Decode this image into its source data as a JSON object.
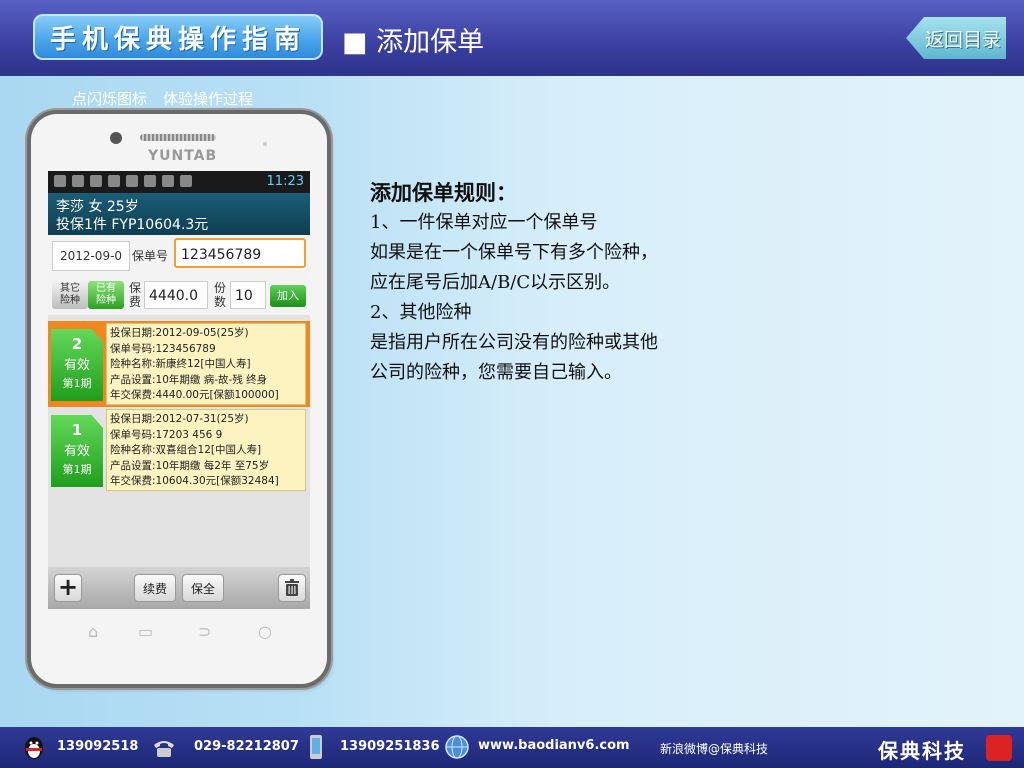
{
  "header": {
    "logo_text": "手机保典操作指南",
    "title": "■ 添加保单",
    "back_button": "返回目录"
  },
  "hint": {
    "part1": "点闪烁图标",
    "part2": "体验操作过程"
  },
  "phone": {
    "brand": "YUNTAB",
    "time": "11:23",
    "summary_line1": "李莎 女 25岁",
    "summary_line2": "投保1件 FYP10604.3元",
    "date_value": "2012-09-0",
    "policy_no_label": "保单号",
    "policy_no_value": "123456789",
    "tab_other": "其它\n险种",
    "tab_existing": "已有\n险种",
    "fee_label": "保\n费",
    "fee_value": "4440.0",
    "qty_label": "份\n数",
    "qty_value": "10",
    "add_button": "加入",
    "cards": [
      {
        "number": "2",
        "status": "有效",
        "period": "第1期",
        "lines": [
          "投保日期:2012-09-05(25岁)",
          "保单号码:123456789",
          "险种名称:新康终12[中国人寿]",
          "产品设置:10年期缴 病-故-残 终身",
          "年交保费:4440.00元[保额100000]"
        ]
      },
      {
        "number": "1",
        "status": "有效",
        "period": "第1期",
        "lines": [
          "投保日期:2012-07-31(25岁)",
          "保单号码:17203 456 9",
          "险种名称:双喜组合12[中国人寿]",
          "产品设置:10年期缴 每2年 至75岁",
          "年交保费:10604.30元[保额32484]"
        ]
      }
    ],
    "toolbar": {
      "plus": "+",
      "renew": "续费",
      "keep": "保全"
    }
  },
  "rules": {
    "heading": "添加保单规则：",
    "line1": "1、一件保单对应一个保单号",
    "line2": "如果是在一个保单号下有多个险种，",
    "line3": "应在尾号后加A/B/C以示区别。",
    "line4": "2、其他险种",
    "line5": "是指用户所在公司没有的险种或其他",
    "line6": "公司的险种，您需要自己输入。"
  },
  "footer": {
    "qq": "139092518",
    "tel": "029-82212807",
    "mobile": "13909251836",
    "website": "www.baodianv6.com",
    "weibo": "新浪微博@保典科技",
    "brand": "保典科技"
  }
}
